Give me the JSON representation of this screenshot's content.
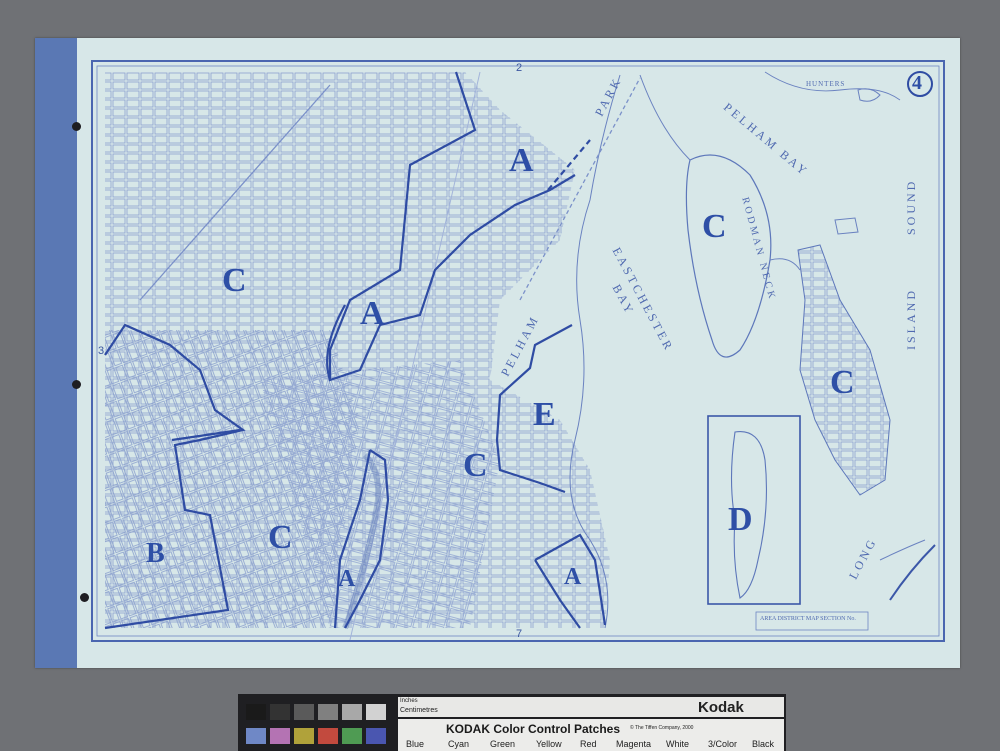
{
  "map": {
    "plate_number": "4",
    "edge_numbers": {
      "top": "2",
      "left": "3",
      "bottom": "7"
    },
    "zones": [
      {
        "id": "zone-a-north",
        "label": "A"
      },
      {
        "id": "zone-c-northwest",
        "label": "C"
      },
      {
        "id": "zone-a-river",
        "label": "A"
      },
      {
        "id": "zone-c-west",
        "label": "C"
      },
      {
        "id": "zone-b-southwest",
        "label": "B"
      },
      {
        "id": "zone-c-south",
        "label": "C"
      },
      {
        "id": "zone-a-bronx-river",
        "label": "A"
      },
      {
        "id": "zone-c-central",
        "label": "C"
      },
      {
        "id": "zone-e",
        "label": "E"
      },
      {
        "id": "zone-a-southeast",
        "label": "A"
      },
      {
        "id": "zone-c-rodman-neck",
        "label": "C"
      },
      {
        "id": "zone-c-city-island",
        "label": "C"
      },
      {
        "id": "zone-d-hart-island",
        "label": "D"
      }
    ],
    "water_labels": {
      "park": "PARK",
      "pelham_bay": "PELHAM BAY",
      "eastchester": "EASTCHESTER",
      "bay": "BAY",
      "pelham": "PELHAM",
      "rodman": "RODMAN NECK",
      "island": "ISLAND",
      "sound": "SOUND",
      "long": "LONG",
      "hunters": "HUNTERS"
    },
    "inset_caption": "AREA DISTRICT MAP SECTION No."
  },
  "color_target": {
    "title": "KODAK Color Control Patches",
    "copyright": "© The Tiffen Company, 2000",
    "brand": "Kodak",
    "cm_label": "Centimetres",
    "inch_label": "Inches",
    "patches": [
      {
        "name": "Blue",
        "color": "#2f3fa0"
      },
      {
        "name": "Cyan",
        "color": "#2aa3d6"
      },
      {
        "name": "Green",
        "color": "#2f8f3a"
      },
      {
        "name": "Yellow",
        "color": "#e7d33a"
      },
      {
        "name": "Red",
        "color": "#c42a25"
      },
      {
        "name": "Magenta",
        "color": "#b43a8e"
      },
      {
        "name": "White",
        "color": "#f4f4f2"
      },
      {
        "name": "3/Color",
        "color": "#3a3a3a"
      },
      {
        "name": "Black",
        "color": "#0f0f0f"
      }
    ],
    "gray_steps": [
      "#1a1a1a",
      "#333333",
      "#5a5a5a",
      "#808080",
      "#a8a8a8",
      "#d2d2d2",
      "#f0f0f0"
    ],
    "mini_patches": [
      "#6f88c6",
      "#b473b3",
      "#b0a23a",
      "#c24a3e",
      "#4f9b53",
      "#4a56b0"
    ]
  },
  "colors": {
    "paper": "#d7e7e8",
    "ink": "#3552a8",
    "binding": "#5a78b4",
    "background": "#6f7175"
  }
}
